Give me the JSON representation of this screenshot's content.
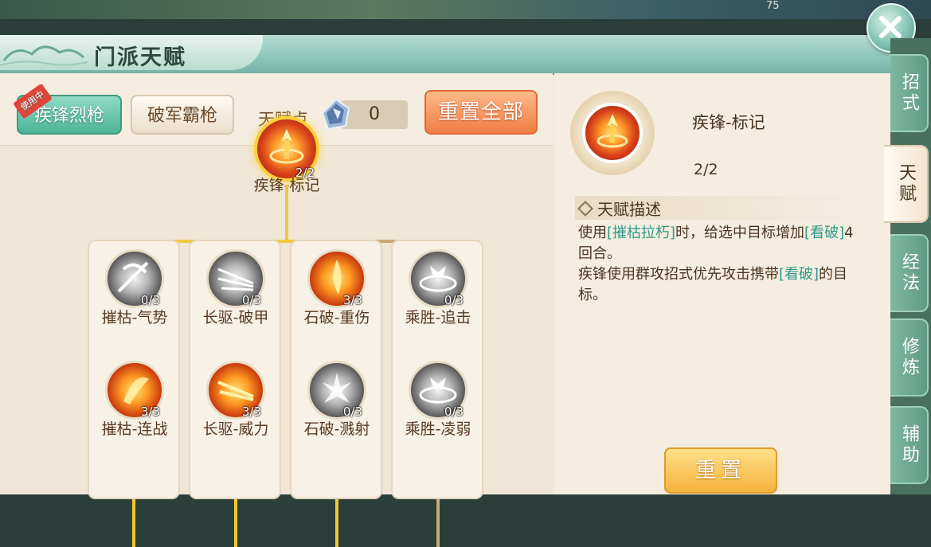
{
  "window": {
    "title": "门派天赋",
    "top_number": "75"
  },
  "header": {
    "tabs": [
      {
        "label": "疾锋烈枪",
        "badge": "使用中",
        "active": true
      },
      {
        "label": "破军霸枪",
        "active": false
      }
    ],
    "points_label": "天赋点",
    "points_value": "0",
    "reset_all_label": "重置全部"
  },
  "tree": {
    "root": {
      "name": "疾锋-标记",
      "count": "2/2",
      "icon": "fire-mark-icon"
    },
    "columns": [
      {
        "nodes": [
          {
            "name": "摧枯-气势",
            "count": "0/3",
            "icon": "spear-spin-icon",
            "style": "gray"
          },
          {
            "name": "摧枯-连战",
            "count": "3/3",
            "icon": "fire-slash-icon",
            "style": "fire"
          }
        ]
      },
      {
        "nodes": [
          {
            "name": "长驱-破甲",
            "count": "0/3",
            "icon": "spear-pierce-icon",
            "style": "gray"
          },
          {
            "name": "长驱-威力",
            "count": "3/3",
            "icon": "fire-pierce-icon",
            "style": "fire"
          }
        ]
      },
      {
        "nodes": [
          {
            "name": "石破-重伤",
            "count": "3/3",
            "icon": "fire-burst-icon",
            "style": "fire"
          },
          {
            "name": "石破-溅射",
            "count": "0/3",
            "icon": "splash-icon",
            "style": "gray"
          }
        ]
      },
      {
        "nodes": [
          {
            "name": "乘胜-追击",
            "count": "0/3",
            "icon": "beast-chase-icon",
            "style": "gray"
          },
          {
            "name": "乘胜-凌弱",
            "count": "0/3",
            "icon": "beast-weak-icon",
            "style": "gray"
          }
        ]
      }
    ]
  },
  "detail": {
    "name": "疾锋-标记",
    "level": "2/2",
    "desc_title": "天赋描述",
    "desc_line1_a": "使用",
    "desc_line1_hl": "[摧枯拉朽]",
    "desc_line1_b": "时，给选中目标增加",
    "desc_line1_hl2": "[看破]",
    "desc_line1_c": "4回合。",
    "desc_line2_a": "疾锋使用群攻招式优先攻击携带",
    "desc_line2_hl": "[看破]",
    "desc_line2_b": "的目标。",
    "reset_label": "重置"
  },
  "side_tabs": [
    {
      "label": "招式",
      "active": false
    },
    {
      "label": "天赋",
      "active": true
    },
    {
      "label": "经法",
      "active": false
    },
    {
      "label": "修炼",
      "active": false
    },
    {
      "label": "辅助",
      "active": false
    }
  ],
  "colors": {
    "accent_teal": "#4db497",
    "accent_orange": "#f07c45",
    "highlight_text": "#2e9a8a",
    "tree_line_active": "#f0c63c"
  }
}
